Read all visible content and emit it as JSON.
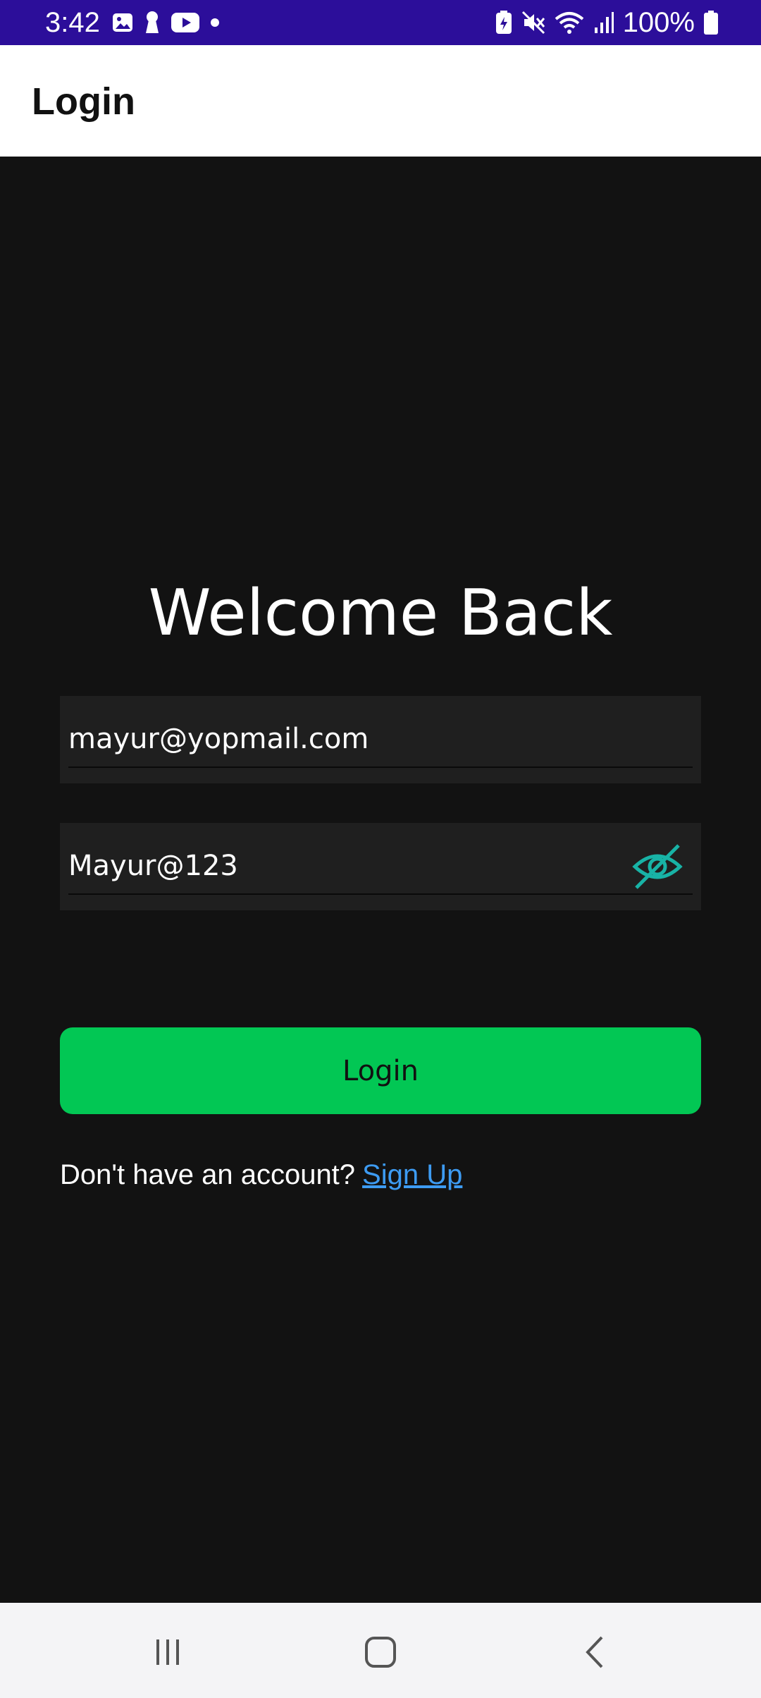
{
  "status_bar": {
    "time": "3:42",
    "battery": "100%",
    "left_icons": [
      "gallery-icon",
      "keyhole-icon",
      "youtube-icon",
      "dot-icon"
    ],
    "right_icons": [
      "battery-saver-icon",
      "mute-icon",
      "wifi-icon",
      "signal-icon",
      "battery-icon"
    ],
    "background": "#2c0e9a"
  },
  "app_bar": {
    "title": "Login"
  },
  "main": {
    "heading": "Welcome Back",
    "email_value": "mayur@yopmail.com",
    "password_value": "Mayur@123",
    "password_toggle_icon": "eye-off-icon",
    "login_label": "Login",
    "signup_prompt": "Don't have an account?",
    "signup_link": "Sign Up",
    "colors": {
      "background": "#121212",
      "field": "#1f1f1f",
      "button": "#02c754",
      "link": "#3d9bf2",
      "eye_icon": "#18b3a6"
    }
  },
  "nav_bar": {
    "buttons": [
      "recent-apps-icon",
      "home-icon",
      "back-icon"
    ]
  }
}
